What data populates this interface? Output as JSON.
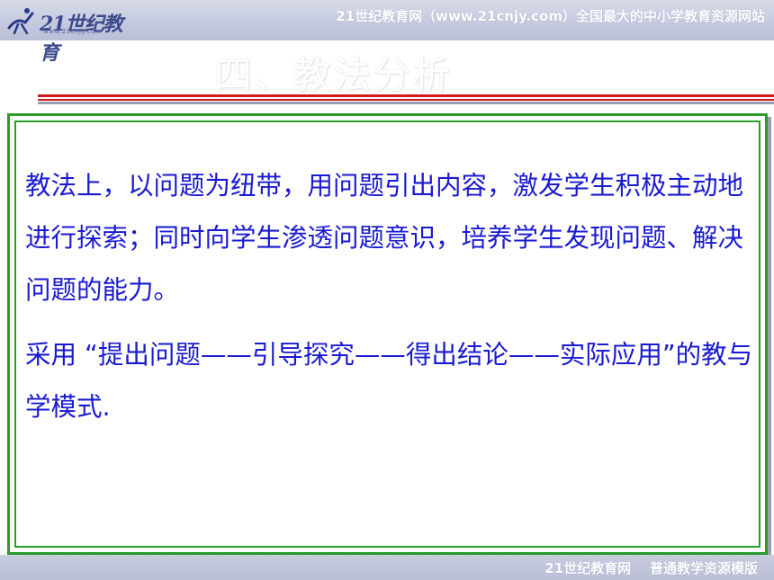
{
  "header": {
    "logo_text": "21世纪教育",
    "logo_sub": "www.21cnjy.com",
    "tagline": "21世纪教育网（www.21cnjy.com）全国最大的中小学教育资源网站"
  },
  "slide": {
    "title": "四、教法分析",
    "paragraphs": [
      "教法上，以问题为纽带，用问题引出内容，激发学生积极主动地进行探索；同时向学生渗透问题意识，培养学生发现问题、解决问题的能力。",
      "采用 “提出问题——引导探究——得出结论——实际应用”的教与学模式."
    ]
  },
  "footer": {
    "text": "21世纪教育网    普通教学资源模版"
  },
  "colors": {
    "body_text": "#1a1ad0",
    "frame": "#2c9a2c",
    "rule": "#d11b1b",
    "banner": "#c4c9de"
  }
}
